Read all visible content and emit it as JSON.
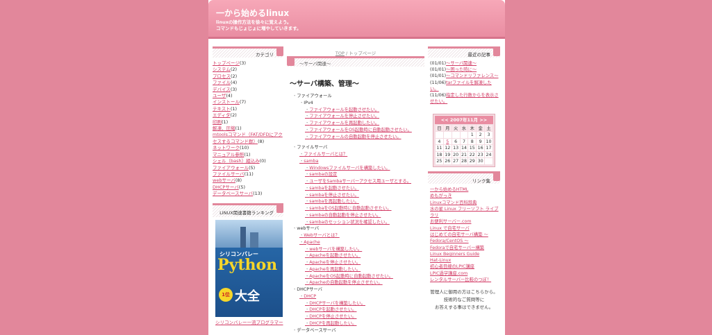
{
  "header": {
    "title": "一から始めるlinux",
    "description": "linuxの操作方法を徐々に覚えよう。\nコマンドもじょじょに増やしていきます。"
  },
  "left": {
    "category_title": "カテゴリ",
    "categories": [
      {
        "name": "トップページ",
        "count": "(3)"
      },
      {
        "name": "システム",
        "count": "(2)"
      },
      {
        "name": "プロセス",
        "count": "(2)"
      },
      {
        "name": "ファイル",
        "count": "(4)"
      },
      {
        "name": "デバイス",
        "count": "(3)"
      },
      {
        "name": "ユーザ",
        "count": "(4)"
      },
      {
        "name": "インストール",
        "count": "(7)"
      },
      {
        "name": "テキスト",
        "count": "(1)"
      },
      {
        "name": "エディタ",
        "count": "(2)"
      },
      {
        "name": "印刷",
        "count": "(1)"
      },
      {
        "name": "解凍、圧縮",
        "count": "(1)"
      },
      {
        "name": "mtoolsコマンド（FAT/DFDにアクセスするコマンド群）",
        "count": "(8)"
      },
      {
        "name": "ネットワーク",
        "count": "(10)"
      },
      {
        "name": "マニュアル参照",
        "count": "(1)"
      },
      {
        "name": "シェル（bash）組込み",
        "count": "(0)"
      },
      {
        "name": "ファイアウォール",
        "count": "(5)"
      },
      {
        "name": "ファイルサーバ",
        "count": "(11)"
      },
      {
        "name": "webサーバ",
        "count": "(8)"
      },
      {
        "name": "DHCPサーバ",
        "count": "(5)"
      },
      {
        "name": "データベースサーバ",
        "count": "(13)"
      }
    ],
    "ranking_title": "LINUX関連書籍ランキング",
    "book": {
      "line1": "シリコンバレー",
      "line2": "Python",
      "line3": "大全",
      "badge": "1位"
    },
    "ranking_caption": "シリコンバレー一流プログラマー"
  },
  "center": {
    "topnav_link": "TOP",
    "topnav_sep": " / ",
    "topnav_current": "トップページ",
    "category_label": "〜サーバ関連〜",
    "post_title": "〜サーバ構築、管理〜",
    "tree": [
      {
        "text": "ファイアウォール",
        "lvl": 0,
        "link": false
      },
      {
        "text": "IPv4",
        "lvl": 1,
        "link": false
      },
      {
        "text": "ファイアウォールを起動させたい。",
        "lvl": 2,
        "link": true
      },
      {
        "text": "ファイアウォールを停止させたい。",
        "lvl": 2,
        "link": true
      },
      {
        "text": "ファイアウォールを再起動したい。",
        "lvl": 2,
        "link": true
      },
      {
        "text": "ファイアウォールをOS起動時に自動起動させたい。",
        "lvl": 2,
        "link": true
      },
      {
        "text": "ファイアウォールの自動起動を停止させたい。",
        "lvl": 2,
        "link": true
      },
      {
        "text": "",
        "lvl": 0,
        "link": false
      },
      {
        "text": "ファイルサーバ",
        "lvl": 0,
        "link": false
      },
      {
        "text": "ファイルサーバとは？",
        "lvl": 1,
        "link": true
      },
      {
        "text": "samba",
        "lvl": 1,
        "link": true
      },
      {
        "text": "Windowsファイルサーバを構築したい。",
        "lvl": 2,
        "link": true
      },
      {
        "text": "sambaの設定",
        "lvl": 2,
        "link": true
      },
      {
        "text": "ユーザをSambaサーバーアクセス用ユーザとする。",
        "lvl": 2,
        "link": true
      },
      {
        "text": "sambaを起動させたい。",
        "lvl": 2,
        "link": true
      },
      {
        "text": "sambaを停止させたい。",
        "lvl": 2,
        "link": true
      },
      {
        "text": "sambaを再起動したい。",
        "lvl": 2,
        "link": true
      },
      {
        "text": "sambaをOS起動時に自動起動させたい。",
        "lvl": 2,
        "link": true
      },
      {
        "text": "sambaの自動起動を停止させたい。",
        "lvl": 2,
        "link": true
      },
      {
        "text": "sambaのセッション状況を確認したい。",
        "lvl": 2,
        "link": true
      },
      {
        "text": "webサーバ",
        "lvl": 0,
        "link": false
      },
      {
        "text": "Webサーバとは？",
        "lvl": 1,
        "link": true
      },
      {
        "text": "Apache",
        "lvl": 1,
        "link": true
      },
      {
        "text": "webサーバを構築したい。",
        "lvl": 2,
        "link": true
      },
      {
        "text": "Apacheを起動させたい。",
        "lvl": 2,
        "link": true
      },
      {
        "text": "Apacheを停止させたい。",
        "lvl": 2,
        "link": true
      },
      {
        "text": "Apacheを再起動したい。",
        "lvl": 2,
        "link": true
      },
      {
        "text": "ApacheをOS起動時に自動起動させたい。",
        "lvl": 2,
        "link": true
      },
      {
        "text": "Apacheの自動起動を停止させたい。",
        "lvl": 2,
        "link": true
      },
      {
        "text": "DHCPサーバ",
        "lvl": 0,
        "link": false
      },
      {
        "text": "DHCP",
        "lvl": 1,
        "link": true
      },
      {
        "text": "DHCPサーバを構築したい。",
        "lvl": 2,
        "link": true
      },
      {
        "text": "DHCPを起動させたい。",
        "lvl": 2,
        "link": true
      },
      {
        "text": "DHCPを停止させたい。",
        "lvl": 2,
        "link": true
      },
      {
        "text": "DHCPを再起動したい。",
        "lvl": 2,
        "link": true
      },
      {
        "text": "データベースサーバ",
        "lvl": 0,
        "link": false
      }
    ]
  },
  "right": {
    "recent_title": "最近の記事",
    "recent": [
      {
        "date": "(01/01)",
        "text": "〜サーバ関連〜"
      },
      {
        "date": "(01/01)",
        "text": "〜困った時に〜"
      },
      {
        "date": "(01/01)",
        "text": "〜コマンドリファレンス〜"
      },
      {
        "date": "(11/06)",
        "text": "tarファイルを解凍したい。"
      },
      {
        "date": "(11/06)",
        "text": "指定した行数からを表示させたい。"
      }
    ],
    "calendar": {
      "prev": "<<",
      "month": "2007年11月",
      "next": ">>",
      "dow": [
        "日",
        "月",
        "火",
        "水",
        "木",
        "金",
        "土"
      ],
      "weeks": [
        [
          "",
          "",
          "",
          "",
          "1",
          "2",
          "3"
        ],
        [
          "4",
          "5",
          "6",
          "7",
          "8",
          "9",
          "10"
        ],
        [
          "11",
          "12",
          "13",
          "14",
          "15",
          "16",
          "17"
        ],
        [
          "18",
          "19",
          "20",
          "21",
          "22",
          "23",
          "24"
        ],
        [
          "25",
          "26",
          "27",
          "28",
          "29",
          "30",
          ""
        ]
      ]
    },
    "links_title": "リンク集",
    "links": [
      "一から始めるHTML",
      "めもがっき",
      "Linuxコマンド百科辞典",
      "水の星 Linux フリーソフト ライブラリ",
      "お便利サーバー.com",
      "Linux で自宅サーバ",
      "はじめての自宅サーバ構築 〜",
      "Fedora/CentOS 〜",
      "Fedoraで自宅サーバー構築",
      "Linux Beginners Guide",
      "Hat-Linux",
      "初心者目線のLPIC講座",
      "LPIC過学講座.com",
      "レンタルサーバー比較のつぼ！"
    ],
    "admin_note": "管理人に御用の方はこちらから。\n技術的なご質問等に\nお答えする事はできません。"
  },
  "colors": {
    "background": "#e2879b",
    "accent": "#e98da2",
    "link": "#d23a64"
  }
}
